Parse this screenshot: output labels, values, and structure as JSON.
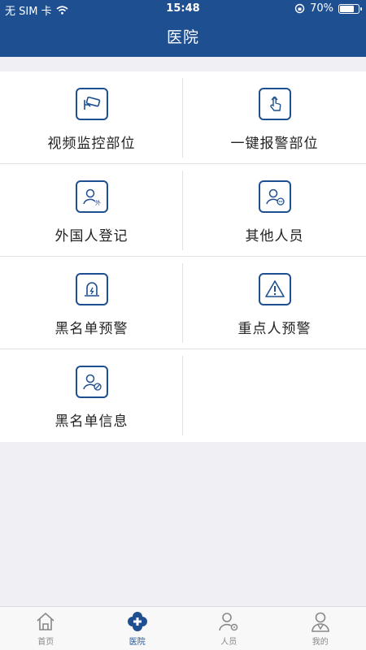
{
  "status": {
    "carrier": "无 SIM 卡",
    "time": "15:48",
    "battery": "70%",
    "battery_level": 0.7
  },
  "header": {
    "title": "医院"
  },
  "grid": {
    "items": [
      {
        "label": "视频监控部位",
        "icon": "camera-icon"
      },
      {
        "label": "一键报警部位",
        "icon": "touch-alarm-icon"
      },
      {
        "label": "外国人登记",
        "icon": "foreigner-icon"
      },
      {
        "label": "其他人员",
        "icon": "other-person-icon"
      },
      {
        "label": "黑名单预警",
        "icon": "siren-icon"
      },
      {
        "label": "重点人预警",
        "icon": "warning-icon"
      },
      {
        "label": "黑名单信息",
        "icon": "blocked-person-icon"
      }
    ]
  },
  "tabbar": {
    "items": [
      {
        "label": "首页",
        "icon": "home-icon"
      },
      {
        "label": "医院",
        "icon": "hospital-cross-icon",
        "active": true
      },
      {
        "label": "人员",
        "icon": "person-gear-icon"
      },
      {
        "label": "我的",
        "icon": "profile-icon"
      }
    ]
  },
  "colors": {
    "primary": "#1d4f91",
    "background": "#efeff4",
    "inactive": "#888888"
  }
}
